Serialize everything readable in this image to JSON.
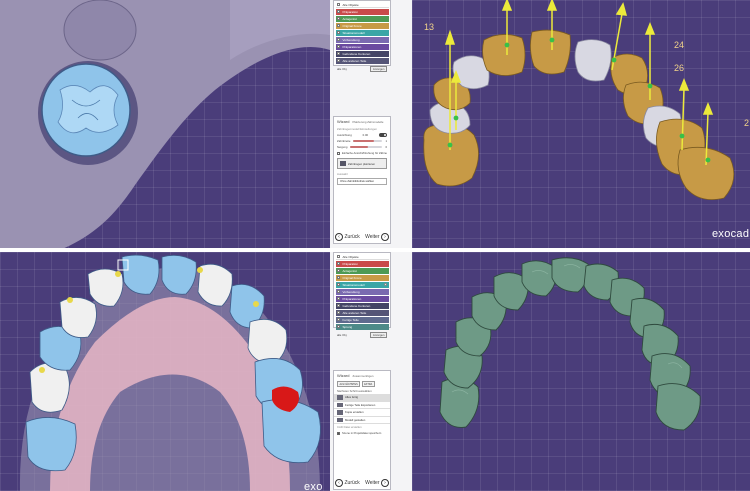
{
  "colors": {
    "workspace": "#4a3d7a",
    "gingiva": "#9a92b2",
    "tooth_blue": "#8fc4ea",
    "crown_gold": "#c79a46",
    "crown_white": "#d8d8e2",
    "model_green": "#6e9a86",
    "pink_gum": "#e8b6c6",
    "red_prep": "#d81818",
    "axis_yellow": "#ecea3b",
    "anchor_green": "#38c048"
  },
  "labels": {
    "tooth_13": "13",
    "tooth_24": "24",
    "tooth_26": "26",
    "tooth_2x": "2",
    "brand_top": "exocad",
    "brand_bottom": "exo"
  },
  "object_panel_top": {
    "rows": [
      {
        "label": "Alle Objekte",
        "color": "#ffffff"
      },
      {
        "label": "Präparation",
        "color": "#c94a4a"
      },
      {
        "label": "Antagonist",
        "color": "#4d9a55"
      },
      {
        "label": "Original Krone",
        "color": "#c79a46"
      },
      {
        "label": "Situationsmodell",
        "color": "#3aa6a6"
      },
      {
        "label": "Vorbereitung",
        "color": "#7a6ab0"
      },
      {
        "label": "Präparationen",
        "color": "#6a4aa0"
      },
      {
        "label": "Gefundene Konturen",
        "color": "#444466"
      },
      {
        "label": "Alle anderen Teile",
        "color": "#555577"
      }
    ],
    "footer_left": "alle Obj.",
    "footer_button": "Anzeigen"
  },
  "object_panel_bottom": {
    "rows": [
      {
        "label": "Alle Objekte",
        "color": "#ffffff"
      },
      {
        "label": "Präparation",
        "color": "#c94a4a"
      },
      {
        "label": "Antagonist",
        "color": "#4d9a55"
      },
      {
        "label": "Original Krone",
        "color": "#c79a46"
      },
      {
        "label": "Situationsmodell",
        "color": "#3aa6a6"
      },
      {
        "label": "Vorbereitung",
        "color": "#7a6ab0"
      },
      {
        "label": "Präparationen",
        "color": "#6a4aa0"
      },
      {
        "label": "Gefundene Konturen",
        "color": "#444466"
      },
      {
        "label": "Alle anderen Teile",
        "color": "#555577"
      },
      {
        "label": "Fertige Teile",
        "color": "#5f6a8e"
      },
      {
        "label": "Sprung",
        "color": "#4d8a88"
      }
    ],
    "footer_left": "alle Obj.",
    "footer_button": "Anzeigen"
  },
  "wizard_top": {
    "title": "Wizard",
    "subtitle": "Platzierung Zahnmodelle",
    "section": "Zahnbogenmodell Einstellungen",
    "rows": [
      {
        "label": "Ausrichtung",
        "value": "0.00"
      },
      {
        "label": "Zahnbreite",
        "value": "1"
      },
      {
        "label": "Neigung",
        "value": "0"
      }
    ],
    "checkbox": "Einfache Ansicht/Drehung für Zähne",
    "button": "Zahnbogen platzieren",
    "select_label": "Auswahl",
    "select_value": "Ohne Zahnbibliothek wählen",
    "back": "Zurück",
    "next": "Weiter"
  },
  "wizard_bottom": {
    "title": "Wizard",
    "subtitle": "Zusammenfügen",
    "tab1": "ALS NÄCHSTES",
    "tab2": "EXTRA",
    "section": "Nächsten Schritt auswählen",
    "items": [
      {
        "label": "Alles fertig"
      },
      {
        "label": "Fertige Teile Exportieren"
      },
      {
        "label": "Kopie erstellen"
      },
      {
        "label": "Modell gestalten"
      }
    ],
    "hint": "CAD Datei erstellen",
    "checkbox": "Szene in Projektdatei speichern",
    "back": "Zurück",
    "next": "Weiter"
  }
}
